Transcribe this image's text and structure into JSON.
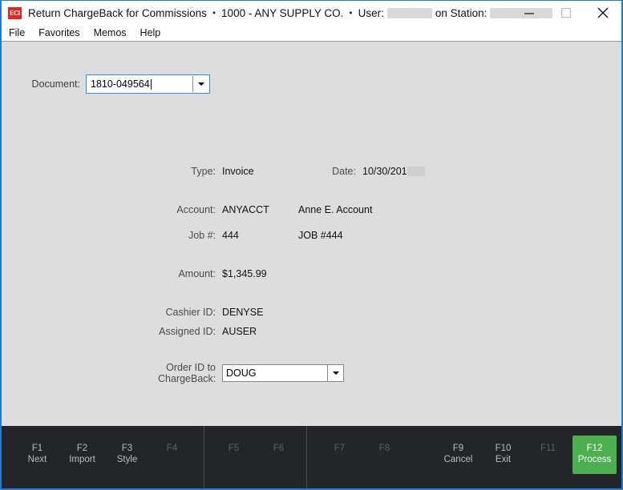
{
  "window": {
    "app_icon_text": "ECI",
    "title": "Return ChargeBack for Commissions",
    "separator": "•",
    "company": "1000 - ANY SUPPLY CO.",
    "user_label": "User:",
    "station_label": "on Station:",
    "user_value": "",
    "station_value": "",
    "controls": {
      "minimize": "minimize-icon",
      "maximize": "maximize-icon",
      "close": "close-icon"
    },
    "accent_color": "#1a7fd4"
  },
  "menu": {
    "items": [
      {
        "label": "File"
      },
      {
        "label": "Favorites"
      },
      {
        "label": "Memos"
      },
      {
        "label": "Help"
      }
    ]
  },
  "form": {
    "document": {
      "label": "Document:",
      "value": "1810-049564",
      "placeholder": ""
    },
    "fields": [
      {
        "label": "Type:",
        "value": "Invoice"
      },
      {
        "label": "Date:",
        "value": "10/30/201"
      },
      {
        "label": "Account:",
        "value": "ANYACCT",
        "secondary": "Anne E. Account"
      },
      {
        "label": "Job #:",
        "value": "444",
        "secondary": "JOB #444"
      },
      {
        "label": "Amount:",
        "value": "$1,345.99"
      },
      {
        "label": "Cashier ID:",
        "value": "DENYSE"
      },
      {
        "label": "Assigned ID:",
        "value": "AUSER"
      }
    ],
    "order_chargeback": {
      "label_line1": "Order ID to",
      "label_line2": "ChargeBack:",
      "value": "DOUG"
    }
  },
  "function_bar": {
    "background_color": "#232528",
    "primary_color": "#4CAF50",
    "groups": [
      {
        "keys": [
          {
            "key": "F1",
            "label": "Next",
            "enabled": true
          },
          {
            "key": "F2",
            "label": "Import",
            "enabled": true
          },
          {
            "key": "F3",
            "label": "Style",
            "enabled": true
          },
          {
            "key": "F4",
            "label": "",
            "enabled": false
          }
        ]
      },
      {
        "keys": [
          {
            "key": "F5",
            "label": "",
            "enabled": false
          },
          {
            "key": "F6",
            "label": "",
            "enabled": false
          }
        ]
      },
      {
        "keys": [
          {
            "key": "F7",
            "label": "",
            "enabled": false
          },
          {
            "key": "F8",
            "label": "",
            "enabled": false
          },
          {
            "key": "F9",
            "label": "Cancel",
            "enabled": true
          },
          {
            "key": "F10",
            "label": "Exit",
            "enabled": true
          },
          {
            "key": "F11",
            "label": "",
            "enabled": false
          },
          {
            "key": "F12",
            "label": "Process",
            "enabled": true,
            "primary": true
          }
        ]
      }
    ]
  }
}
